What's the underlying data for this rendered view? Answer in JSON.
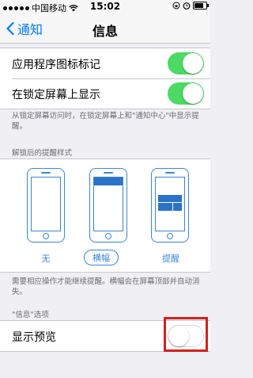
{
  "status_bar": {
    "carrier": "中国移动",
    "time": "15:02"
  },
  "nav": {
    "back_label": "通知",
    "title": "信息"
  },
  "settings": {
    "app_icon_badge": {
      "label": "应用程序图标标记",
      "state": "on"
    },
    "show_on_lock_screen": {
      "label": "在锁定屏幕上显示",
      "state": "on"
    },
    "lock_screen_note": "从锁定屏幕访问时，在锁定屏幕上和\"通知中心\"中显示提醒。"
  },
  "alert_style": {
    "header": "解锁后的提醒样式",
    "options": [
      {
        "label": "无",
        "selected": false
      },
      {
        "label": "横幅",
        "selected": true
      },
      {
        "label": "提醒",
        "selected": false
      }
    ],
    "note": "需要相应操作才能继续提醒。横幅会在屏幕顶部并自动消失。"
  },
  "message_options": {
    "header": "\"信息\"选项",
    "show_preview": {
      "label": "显示预览",
      "state": "off"
    }
  },
  "colors": {
    "accent": "#007aff",
    "toggle_on": "#4cd964",
    "highlight": "#d32020"
  }
}
